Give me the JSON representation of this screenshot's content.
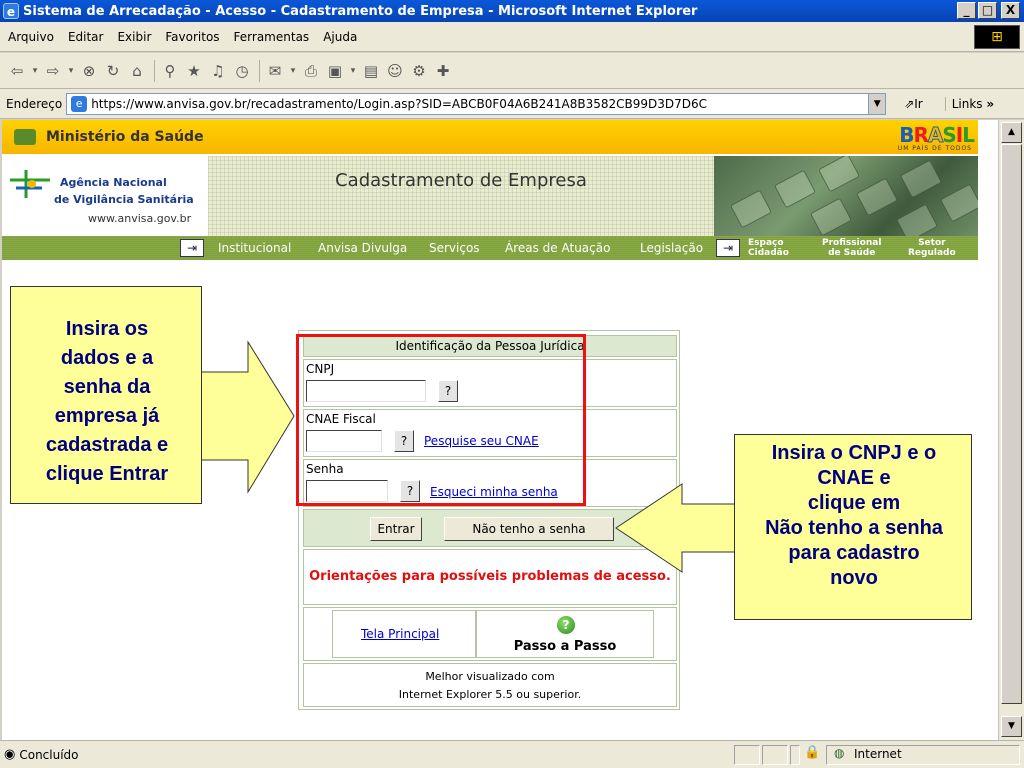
{
  "window": {
    "title": "Sistema de Arrecadação - Acesso - Cadastramento de Empresa - Microsoft Internet Explorer",
    "minimize": "_",
    "maximize": "□",
    "close": "X"
  },
  "menu": [
    "Arquivo",
    "Editar",
    "Exibir",
    "Favoritos",
    "Ferramentas",
    "Ajuda"
  ],
  "address": {
    "label": "Endereço",
    "url": "https://www.anvisa.gov.br/recadastramento/Login.asp?SID=ABCB0F04A6B241A8B3582CB99D3D7D6C",
    "go": "Ir",
    "links": "Links"
  },
  "page": {
    "ministry": "Ministério da Saúde",
    "brasil": "BRASIL",
    "brasil_sub": "UM PAÍS DE TODOS",
    "agency_line1": "Agência Nacional",
    "agency_line2": "de Vigilância Sanitária",
    "agency_url": "www.anvisa.gov.br",
    "banner_title": "Cadastramento de Empresa",
    "nav": [
      "Institucional",
      "Anvisa Divulga",
      "Serviços",
      "Áreas de Atuação",
      "Legislação"
    ],
    "nav_right": [
      {
        "line1": "Espaço",
        "line2": "Cidadão"
      },
      {
        "line1": "Profissional",
        "line2": "de Saúde"
      },
      {
        "line1": "Setor",
        "line2": "Regulado"
      }
    ]
  },
  "form": {
    "header": "Identificação da Pessoa Jurídica",
    "cnpj_label": "CNPJ",
    "cnpj_value": "",
    "cnae_label": "CNAE Fiscal",
    "cnae_value": "",
    "cnae_link": "Pesquise seu CNAE",
    "senha_label": "Senha",
    "senha_value": "",
    "senha_link": "Esqueci minha senha",
    "help_btn": "?",
    "enter_btn": "Entrar",
    "no_password_btn": "Não tenho a senha",
    "warning": "Orientações para possíveis problemas de acesso.",
    "home_link": "Tela Principal",
    "step_by_step": "Passo a Passo",
    "best_view_1": "Melhor visualizado com",
    "best_view_2": "Internet Explorer 5.5 ou superior."
  },
  "callouts": {
    "left": "Insira os\ndados e a\nsenha da\nempresa  já\ncadastrada e\nclique Entrar",
    "right": "Insira o CNPJ e o\nCNAE e\nclique em\nNão tenho a senha\npara cadastro\nnovo"
  },
  "status": {
    "text": "Concluído",
    "zone": "Internet"
  },
  "colors": {
    "title_bar": "#0843b4",
    "ministry_bar": "#ffd200",
    "nav_bar": "#7fa23a",
    "callout_bg": "#ffff99",
    "callout_text": "#000080",
    "highlight_frame": "#ee1111",
    "warning_text": "#e01010"
  }
}
